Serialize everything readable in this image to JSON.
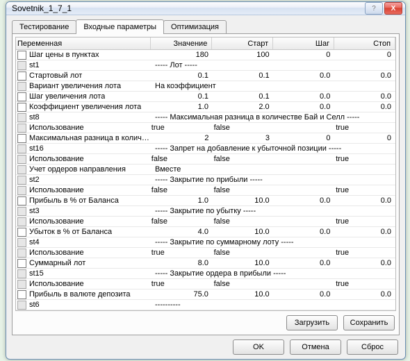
{
  "window": {
    "title": "Sovetnik_1_7_1"
  },
  "window_controls": {
    "help": "?",
    "close": "X"
  },
  "tabs": {
    "items": [
      {
        "label": "Тестирование"
      },
      {
        "label": "Входные параметры"
      },
      {
        "label": "Оптимизация"
      }
    ],
    "active": 1
  },
  "grid": {
    "headers": {
      "name": "Переменная",
      "value": "Значение",
      "start": "Старт",
      "step": "Шаг",
      "stop": "Стоп"
    },
    "rows": [
      {
        "kind": "num",
        "chk": "off",
        "name": "Шаг цены в пунктах",
        "value": "180",
        "start": "100",
        "step": "0",
        "stop": "0"
      },
      {
        "kind": "label",
        "chk": "dis",
        "name": "st1",
        "text": "----- Лот -----"
      },
      {
        "kind": "num",
        "chk": "off",
        "name": "Стартовый лот",
        "value": "0.1",
        "start": "0.1",
        "step": "0.0",
        "stop": "0.0"
      },
      {
        "kind": "text",
        "chk": "dis",
        "name": "Вариант увеличения лота",
        "value": "На коэффициент"
      },
      {
        "kind": "num",
        "chk": "off",
        "name": "Шаг увеличения лота",
        "value": "0.1",
        "start": "0.1",
        "step": "0.0",
        "stop": "0.0"
      },
      {
        "kind": "num",
        "chk": "off",
        "name": "Коэффициент увеличения лота",
        "value": "1.0",
        "start": "2.0",
        "step": "0.0",
        "stop": "0.0"
      },
      {
        "kind": "label",
        "chk": "dis",
        "name": "st8",
        "text": "----- Максимальная разница в количестве Бай и Селл -----"
      },
      {
        "kind": "bool",
        "chk": "dis",
        "name": "Использование",
        "value": "true",
        "start": "false",
        "stop": "true"
      },
      {
        "kind": "num",
        "chk": "off",
        "name": "Максимальная разница в количестве ...",
        "value": "2",
        "start": "3",
        "step": "0",
        "stop": "0"
      },
      {
        "kind": "label",
        "chk": "dis",
        "name": "st16",
        "text": "----- Запрет на добавление к убыточной позиции -----"
      },
      {
        "kind": "bool",
        "chk": "dis",
        "name": "Использование",
        "value": "false",
        "start": "false",
        "stop": "true"
      },
      {
        "kind": "text",
        "chk": "dis",
        "name": "Учет ордеров направления",
        "value": "Вместе"
      },
      {
        "kind": "label",
        "chk": "dis",
        "name": "st2",
        "text": "----- Закрытие по прибыли -----"
      },
      {
        "kind": "bool",
        "chk": "dis",
        "name": "Использование",
        "value": "false",
        "start": "false",
        "stop": "true"
      },
      {
        "kind": "num",
        "chk": "off",
        "name": "Прибыль в % от Баланса",
        "value": "1.0",
        "start": "10.0",
        "step": "0.0",
        "stop": "0.0"
      },
      {
        "kind": "label",
        "chk": "dis",
        "name": "st3",
        "text": "----- Закрытие по убытку -----"
      },
      {
        "kind": "bool",
        "chk": "dis",
        "name": "Использование",
        "value": "false",
        "start": "false",
        "stop": "true"
      },
      {
        "kind": "num",
        "chk": "off",
        "name": "Убыток в % от Баланса",
        "value": "4.0",
        "start": "10.0",
        "step": "0.0",
        "stop": "0.0"
      },
      {
        "kind": "label",
        "chk": "dis",
        "name": "st4",
        "text": "----- Закрытие по суммарному лоту -----"
      },
      {
        "kind": "bool",
        "chk": "dis",
        "name": "Использование",
        "value": "true",
        "start": "false",
        "stop": "true"
      },
      {
        "kind": "num",
        "chk": "off",
        "name": "Суммарный лот",
        "value": "8.0",
        "start": "10.0",
        "step": "0.0",
        "stop": "0.0"
      },
      {
        "kind": "label",
        "chk": "dis",
        "name": "st15",
        "text": "----- Закрытие ордера в прибыли -----"
      },
      {
        "kind": "bool",
        "chk": "dis",
        "name": "Использование",
        "value": "true",
        "start": "false",
        "stop": "true"
      },
      {
        "kind": "num",
        "chk": "off",
        "name": "Прибыль в валюте депозита",
        "value": "75.0",
        "start": "10.0",
        "step": "0.0",
        "stop": "0.0"
      },
      {
        "kind": "label",
        "chk": "dis",
        "name": "st6",
        "text": "----------"
      }
    ]
  },
  "panel_buttons": {
    "load": "Загрузить",
    "save": "Сохранить"
  },
  "bottom_buttons": {
    "ok": "OK",
    "cancel": "Отмена",
    "reset": "Сброс"
  }
}
